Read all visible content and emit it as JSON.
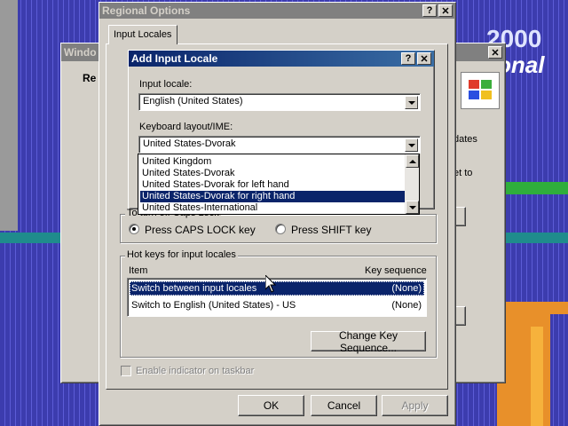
{
  "background": {
    "logo_top": "2000",
    "logo_bottom": "onal"
  },
  "back_window": {
    "title": "Windo",
    "text1": "Re",
    "side1": "dates",
    "side2": "et to"
  },
  "regional": {
    "title": "Regional Options",
    "tab": "Input Locales",
    "caps_group_label": "To turn off Caps Lock",
    "caps_option": "Press CAPS LOCK key",
    "shift_option": "Press SHIFT key",
    "hotkeys_group_label": "Hot keys for input locales",
    "col_item": "Item",
    "col_key": "Key sequence",
    "hotkeys": [
      {
        "item": "Switch between input locales",
        "key": "(None)"
      },
      {
        "item": "Switch to English (United States) - US",
        "key": "(None)"
      }
    ],
    "change_key_button": "Change Key Sequence...",
    "enable_indicator": "Enable indicator on taskbar",
    "ok": "OK",
    "cancel": "Cancel",
    "apply": "Apply"
  },
  "add_locale": {
    "title": "Add Input Locale",
    "input_locale_label": "Input locale:",
    "input_locale_value": "English (United States)",
    "keyboard_label": "Keyboard layout/IME:",
    "keyboard_value": "United States-Dvorak",
    "keyboard_options": [
      "United Kingdom",
      "United States-Dvorak",
      "United States-Dvorak for left hand",
      "United States-Dvorak for right hand",
      "United States-International"
    ],
    "highlighted_option": "United States-Dvorak for right hand"
  },
  "colors": {
    "selection": "#0a246a",
    "face": "#d4d0c8"
  }
}
